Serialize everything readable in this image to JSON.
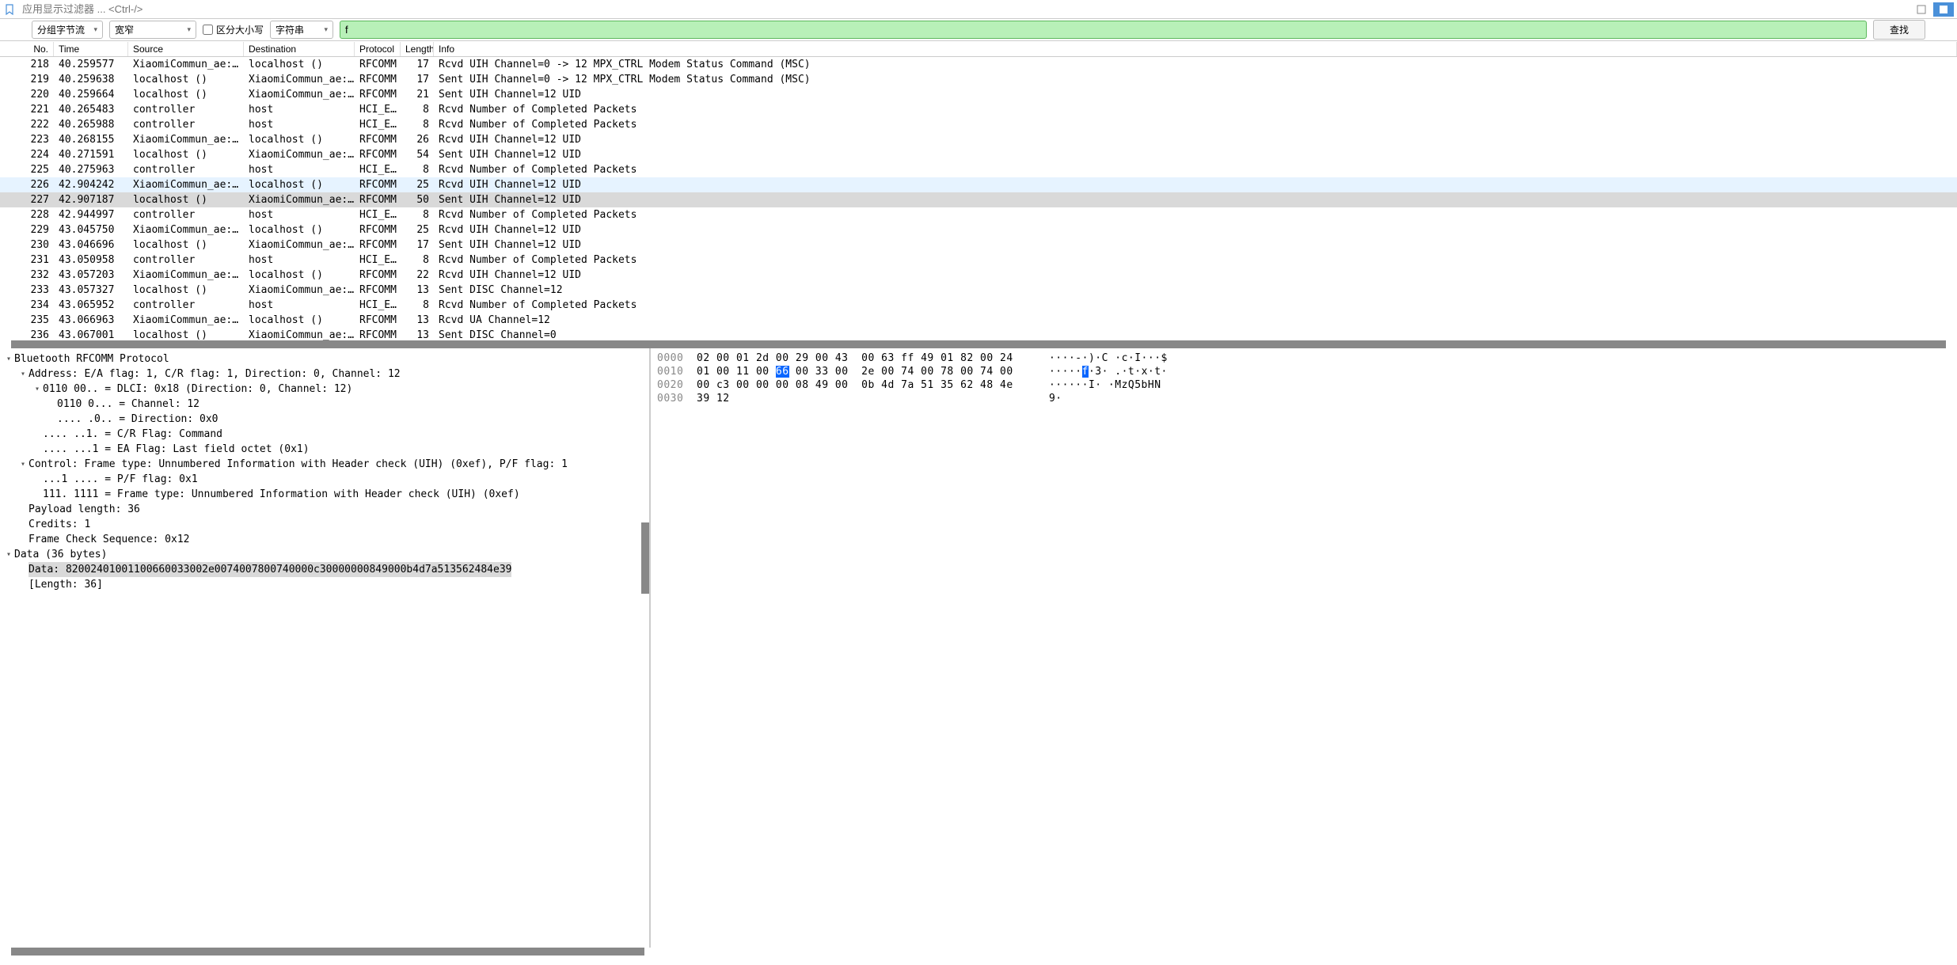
{
  "filter": {
    "placeholder": "应用显示过滤器 ... <Ctrl-/>"
  },
  "toolbar": {
    "dropdown1": "分组字节流",
    "dropdown2": "宽窄",
    "casebox_label": "区分大小写",
    "dropdown3": "字符串",
    "search_value": "f",
    "find_label": "查找"
  },
  "columns": {
    "no": "No.",
    "time": "Time",
    "src": "Source",
    "dst": "Destination",
    "proto": "Protocol",
    "len": "Length",
    "info": "Info"
  },
  "packets": [
    {
      "no": "218",
      "time": "40.259577",
      "src": "XiaomiCommun_ae:…",
      "dst": "localhost ()",
      "proto": "RFCOMM",
      "len": "17",
      "info": "Rcvd UIH Channel=0 -> 12 MPX_CTRL Modem Status Command (MSC)"
    },
    {
      "no": "219",
      "time": "40.259638",
      "src": "localhost ()",
      "dst": "XiaomiCommun_ae:…",
      "proto": "RFCOMM",
      "len": "17",
      "info": "Sent UIH Channel=0 -> 12 MPX_CTRL Modem Status Command (MSC)"
    },
    {
      "no": "220",
      "time": "40.259664",
      "src": "localhost ()",
      "dst": "XiaomiCommun_ae:…",
      "proto": "RFCOMM",
      "len": "21",
      "info": "Sent UIH Channel=12 UID"
    },
    {
      "no": "221",
      "time": "40.265483",
      "src": "controller",
      "dst": "host",
      "proto": "HCI_E…",
      "len": "8",
      "info": "Rcvd Number of Completed Packets"
    },
    {
      "no": "222",
      "time": "40.265988",
      "src": "controller",
      "dst": "host",
      "proto": "HCI_E…",
      "len": "8",
      "info": "Rcvd Number of Completed Packets"
    },
    {
      "no": "223",
      "time": "40.268155",
      "src": "XiaomiCommun_ae:…",
      "dst": "localhost ()",
      "proto": "RFCOMM",
      "len": "26",
      "info": "Rcvd UIH Channel=12 UID"
    },
    {
      "no": "224",
      "time": "40.271591",
      "src": "localhost ()",
      "dst": "XiaomiCommun_ae:…",
      "proto": "RFCOMM",
      "len": "54",
      "info": "Sent UIH Channel=12 UID"
    },
    {
      "no": "225",
      "time": "40.275963",
      "src": "controller",
      "dst": "host",
      "proto": "HCI_E…",
      "len": "8",
      "info": "Rcvd Number of Completed Packets"
    },
    {
      "no": "226",
      "time": "42.904242",
      "src": "XiaomiCommun_ae:…",
      "dst": "localhost ()",
      "proto": "RFCOMM",
      "len": "25",
      "info": "Rcvd UIH Channel=12 UID",
      "hl": 1
    },
    {
      "no": "227",
      "time": "42.907187",
      "src": "localhost ()",
      "dst": "XiaomiCommun_ae:…",
      "proto": "RFCOMM",
      "len": "50",
      "info": "Sent UIH Channel=12 UID",
      "hl": 2
    },
    {
      "no": "228",
      "time": "42.944997",
      "src": "controller",
      "dst": "host",
      "proto": "HCI_E…",
      "len": "8",
      "info": "Rcvd Number of Completed Packets"
    },
    {
      "no": "229",
      "time": "43.045750",
      "src": "XiaomiCommun_ae:…",
      "dst": "localhost ()",
      "proto": "RFCOMM",
      "len": "25",
      "info": "Rcvd UIH Channel=12 UID"
    },
    {
      "no": "230",
      "time": "43.046696",
      "src": "localhost ()",
      "dst": "XiaomiCommun_ae:…",
      "proto": "RFCOMM",
      "len": "17",
      "info": "Sent UIH Channel=12 UID"
    },
    {
      "no": "231",
      "time": "43.050958",
      "src": "controller",
      "dst": "host",
      "proto": "HCI_E…",
      "len": "8",
      "info": "Rcvd Number of Completed Packets"
    },
    {
      "no": "232",
      "time": "43.057203",
      "src": "XiaomiCommun_ae:…",
      "dst": "localhost ()",
      "proto": "RFCOMM",
      "len": "22",
      "info": "Rcvd UIH Channel=12 UID"
    },
    {
      "no": "233",
      "time": "43.057327",
      "src": "localhost ()",
      "dst": "XiaomiCommun_ae:…",
      "proto": "RFCOMM",
      "len": "13",
      "info": "Sent DISC Channel=12"
    },
    {
      "no": "234",
      "time": "43.065952",
      "src": "controller",
      "dst": "host",
      "proto": "HCI_E…",
      "len": "8",
      "info": "Rcvd Number of Completed Packets"
    },
    {
      "no": "235",
      "time": "43.066963",
      "src": "XiaomiCommun_ae:…",
      "dst": "localhost ()",
      "proto": "RFCOMM",
      "len": "13",
      "info": "Rcvd UA Channel=12"
    },
    {
      "no": "236",
      "time": "43.067001",
      "src": "localhost ()",
      "dst": "XiaomiCommun_ae:…",
      "proto": "RFCOMM",
      "len": "13",
      "info": "Sent DISC Channel=0"
    }
  ],
  "tree": [
    {
      "indent": 0,
      "toggle": "v",
      "label": "Bluetooth RFCOMM Protocol"
    },
    {
      "indent": 1,
      "toggle": "v",
      "label": "Address: E/A flag: 1, C/R flag: 1, Direction: 0, Channel: 12"
    },
    {
      "indent": 2,
      "toggle": "v",
      "label": "0110 00.. = DLCI: 0x18 (Direction: 0, Channel: 12)"
    },
    {
      "indent": 3,
      "toggle": "",
      "label": "0110 0... = Channel: 12"
    },
    {
      "indent": 3,
      "toggle": "",
      "label": ".... .0.. = Direction: 0x0"
    },
    {
      "indent": 2,
      "toggle": "",
      "label": ".... ..1. = C/R Flag: Command"
    },
    {
      "indent": 2,
      "toggle": "",
      "label": ".... ...1 = EA Flag: Last field octet (0x1)"
    },
    {
      "indent": 1,
      "toggle": "v",
      "label": "Control: Frame type: Unnumbered Information with Header check (UIH) (0xef), P/F flag: 1"
    },
    {
      "indent": 2,
      "toggle": "",
      "label": "...1 .... = P/F flag: 0x1"
    },
    {
      "indent": 2,
      "toggle": "",
      "label": "111. 1111 = Frame type: Unnumbered Information with Header check (UIH) (0xef)"
    },
    {
      "indent": 1,
      "toggle": "",
      "label": "Payload length: 36"
    },
    {
      "indent": 1,
      "toggle": "",
      "label": "Credits: 1"
    },
    {
      "indent": 1,
      "toggle": "",
      "label": "Frame Check Sequence: 0x12"
    },
    {
      "indent": 0,
      "toggle": "v",
      "label": "Data (36 bytes)"
    },
    {
      "indent": 1,
      "toggle": "",
      "label": "Data: 82002401001100660033002e0074007800740000c30000000849000b4d7a513562484e39",
      "sel": true
    },
    {
      "indent": 1,
      "toggle": "",
      "label": "[Length: 36]"
    }
  ],
  "hex": {
    "rows": [
      {
        "offset": "0000",
        "bytes": "02 00 01 2d 00 29 00 43  00 63 ff 49 01 82 00 24",
        "ascii": "····-·)·C ·c·I···$"
      },
      {
        "offset": "0010",
        "bytes_pre": "01 00 11 00 ",
        "hl": "66",
        "bytes_post": " 00 33 00  2e 00 74 00 78 00 74 00",
        "ascii_pre": "·····",
        "ascii_hl": "f",
        "ascii_post": "·3· .·t·x·t·"
      },
      {
        "offset": "0020",
        "bytes": "00 c3 00 00 00 08 49 00  0b 4d 7a 51 35 62 48 4e",
        "ascii": "······I· ·MzQ5bHN"
      },
      {
        "offset": "0030",
        "bytes": "39 12",
        "ascii": "9·"
      }
    ]
  }
}
